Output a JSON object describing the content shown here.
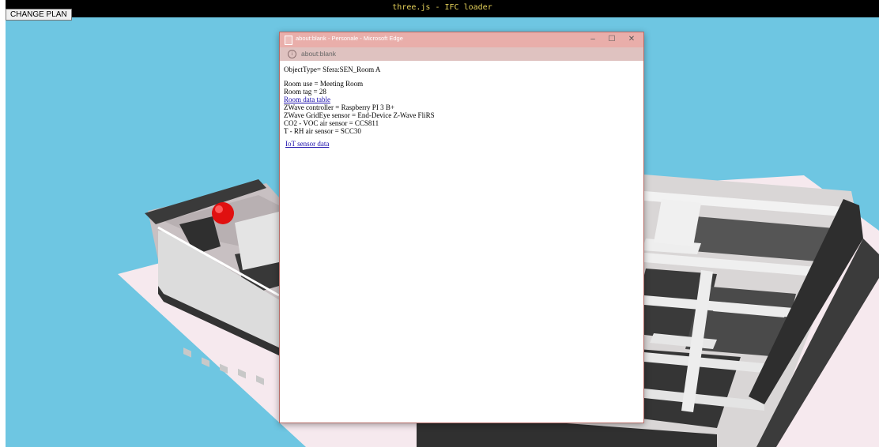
{
  "app": {
    "title": "three.js - IFC loader",
    "change_plan_label": "CHANGE PLAN"
  },
  "popup": {
    "window_title": "about:blank - Personale - Microsoft Edge",
    "url": "about:blank",
    "controls": {
      "minimize": "–",
      "maximize": "☐",
      "close": "✕"
    },
    "object_type": "ObjectType= Sfera:SEN_Room A",
    "room_use": "Room use = Meeting Room",
    "room_tag": "Room tag = 28",
    "room_data_link": "Room data table",
    "zwave_controller": "ZWave controller = Raspberry PI 3 B+",
    "zwave_gridEye": "ZWave GridEye sensor = End-Device Z-Wave FliRS",
    "co2_sensor": "CO2 - VOC air sensor = CCS811",
    "t_rh_sensor": "T - RH air sensor = SCC30",
    "iot_link": "IoT sensor data"
  },
  "colors": {
    "sky": "#6ec6e2",
    "titlebar": "#e9aeaa",
    "sensor_sphere": "#e01010"
  },
  "icons": {
    "page": "page-icon",
    "info": "info-icon",
    "sphere": "sensor-sphere"
  }
}
